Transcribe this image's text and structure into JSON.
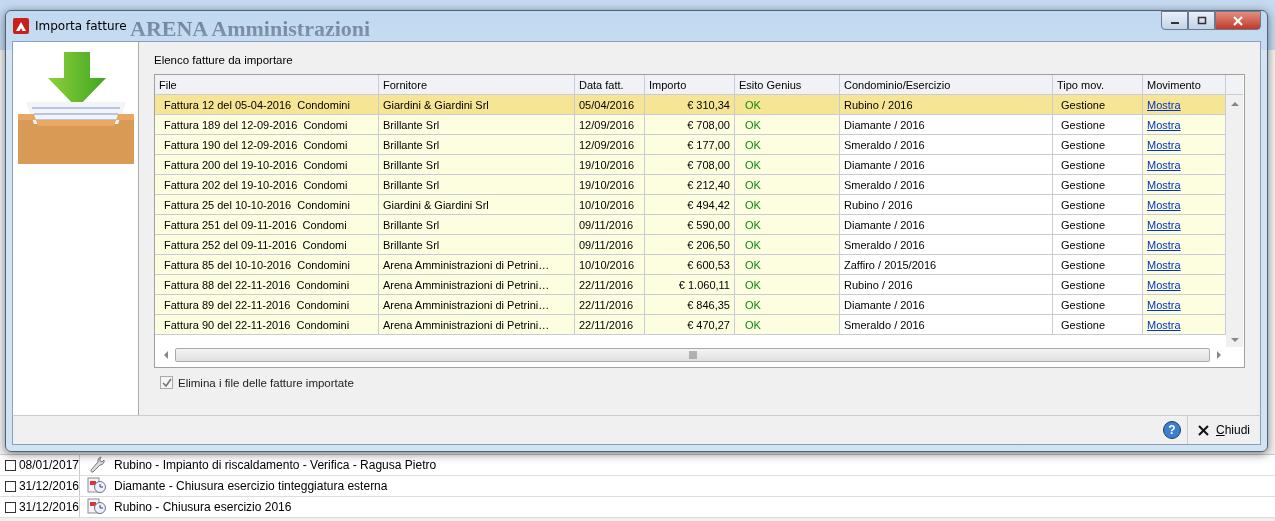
{
  "background_window": {
    "title": "ARENA Amministrazioni",
    "rows": [
      {
        "checked": false,
        "date": "08/01/2017",
        "kind": "wrench",
        "text": "Rubino - Impianto di riscaldamento - Verifica - Ragusa Pietro"
      },
      {
        "checked": false,
        "date": "31/12/2016",
        "kind": "closing",
        "text": "Diamante - Chiusura esercizio tinteggiatura esterna"
      },
      {
        "checked": false,
        "date": "31/12/2016",
        "kind": "closing",
        "text": "Rubino - Chiusura esercizio 2016"
      }
    ]
  },
  "window": {
    "title": "Importa fatture"
  },
  "list_label": "Elenco fatture da importare",
  "table": {
    "columns": [
      "File",
      "Fornitore",
      "Data fatt.",
      "Importo",
      "Esito Genius",
      "Condominio/Esercizio",
      "Tipo mov.",
      "Movimento"
    ],
    "rows": [
      {
        "selected": true,
        "cells": [
          "Fattura 12 del 05-04-2016  Condomini",
          "Giardini & Giardini Srl",
          "05/04/2016",
          "€ 310,34",
          "OK",
          "Rubino / 2016",
          "Gestione",
          "Mostra"
        ]
      },
      {
        "selected": false,
        "cells": [
          "Fattura 189 del 12-09-2016  Condomi",
          "Brillante Srl",
          "12/09/2016",
          "€ 708,00",
          "OK",
          "Diamante / 2016",
          "Gestione",
          "Mostra"
        ]
      },
      {
        "selected": false,
        "cells": [
          "Fattura 190 del 12-09-2016  Condomi",
          "Brillante Srl",
          "12/09/2016",
          "€ 177,00",
          "OK",
          "Smeraldo / 2016",
          "Gestione",
          "Mostra"
        ]
      },
      {
        "selected": false,
        "cells": [
          "Fattura 200 del 19-10-2016  Condomi",
          "Brillante Srl",
          "19/10/2016",
          "€ 708,00",
          "OK",
          "Diamante / 2016",
          "Gestione",
          "Mostra"
        ]
      },
      {
        "selected": false,
        "cells": [
          "Fattura 202 del 19-10-2016  Condomi",
          "Brillante Srl",
          "19/10/2016",
          "€ 212,40",
          "OK",
          "Smeraldo / 2016",
          "Gestione",
          "Mostra"
        ]
      },
      {
        "selected": false,
        "cells": [
          "Fattura 25 del 10-10-2016  Condomini",
          "Giardini & Giardini Srl",
          "10/10/2016",
          "€ 494,42",
          "OK",
          "Rubino / 2016",
          "Gestione",
          "Mostra"
        ]
      },
      {
        "selected": false,
        "cells": [
          "Fattura 251 del 09-11-2016  Condomi",
          "Brillante Srl",
          "09/11/2016",
          "€ 590,00",
          "OK",
          "Diamante / 2016",
          "Gestione",
          "Mostra"
        ]
      },
      {
        "selected": false,
        "cells": [
          "Fattura 252 del 09-11-2016  Condomi",
          "Brillante Srl",
          "09/11/2016",
          "€ 206,50",
          "OK",
          "Smeraldo / 2016",
          "Gestione",
          "Mostra"
        ]
      },
      {
        "selected": false,
        "cells": [
          "Fattura 85 del 10-10-2016  Condomini",
          "Arena Amministrazioni di Petrini…",
          "10/10/2016",
          "€ 600,53",
          "OK",
          "Zaffiro / 2015/2016",
          "Gestione",
          "Mostra"
        ]
      },
      {
        "selected": false,
        "cells": [
          "Fattura 88 del 22-11-2016  Condomini",
          "Arena Amministrazioni di Petrini…",
          "22/11/2016",
          "€ 1.060,11",
          "OK",
          "Rubino / 2016",
          "Gestione",
          "Mostra"
        ]
      },
      {
        "selected": false,
        "cells": [
          "Fattura 89 del 22-11-2016  Condomini",
          "Arena Amministrazioni di Petrini…",
          "22/11/2016",
          "€ 846,35",
          "OK",
          "Diamante / 2016",
          "Gestione",
          "Mostra"
        ]
      },
      {
        "selected": false,
        "cells": [
          "Fattura 90 del 22-11-2016  Condomini",
          "Arena Amministrazioni di Petrini…",
          "22/11/2016",
          "€ 470,27",
          "OK",
          "Smeraldo / 2016",
          "Gestione",
          "Mostra"
        ]
      }
    ]
  },
  "delete_files": {
    "label": "Elimina i file delle fatture importate",
    "checked": true
  },
  "buttons": {
    "help": "?",
    "close": "Chiudi"
  }
}
